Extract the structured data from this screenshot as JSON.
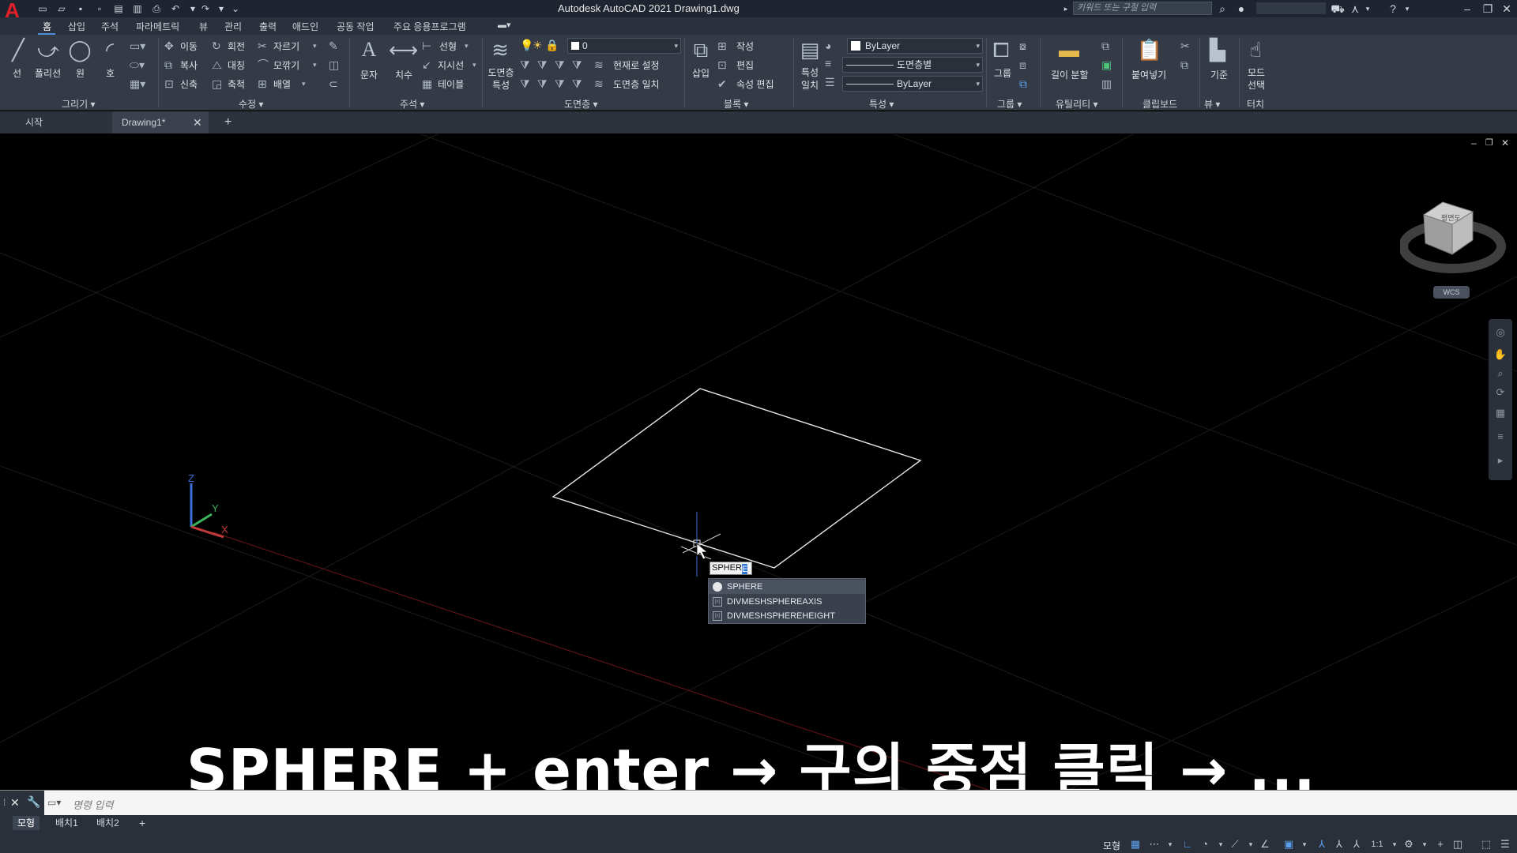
{
  "window": {
    "title": "Autodesk AutoCAD 2021    Drawing1.dwg",
    "search_placeholder": "키워드 또는 구절 입력"
  },
  "menu_tabs": [
    "홈",
    "삽입",
    "주석",
    "파라메트릭",
    "뷰",
    "관리",
    "출력",
    "애드인",
    "공동 작업",
    "주요 응용프로그램"
  ],
  "ribbon": {
    "draw": {
      "title": "그리기 ▾",
      "line": "선",
      "polyline": "폴리선",
      "circle": "원",
      "arc": "호"
    },
    "modify": {
      "title": "수정 ▾",
      "move": "이동",
      "rotate": "회전",
      "trim": "자르기",
      "copy": "복사",
      "mirror": "대칭",
      "fillet": "모깎기",
      "stretch": "신축",
      "scale": "축척",
      "array": "배열"
    },
    "annotation": {
      "title": "주석 ▾",
      "text": "문자",
      "dimension": "치수",
      "linear": "선형",
      "leader": "지시선",
      "table": "테이블"
    },
    "layers": {
      "title": "도면층 ▾",
      "props": "도면층 특성",
      "layer_value": "0",
      "set_current": "현재로 설정",
      "match": "도면층 일치"
    },
    "block": {
      "title": "블록 ▾",
      "insert": "삽입",
      "create": "작성",
      "edit": "편집",
      "edit_attr": "속성 편집"
    },
    "properties": {
      "title": "특성 ▾",
      "match": "특성 일치",
      "color": "ByLayer",
      "linetype": "도면층별",
      "lineweight": "ByLayer"
    },
    "groups": {
      "title": "그룹 ▾",
      "group": "그룹"
    },
    "utilities": {
      "title": "유틸리티 ▾",
      "measure": "길이 분할"
    },
    "clipboard": {
      "title": "클립보드",
      "paste": "붙여넣기"
    },
    "view": {
      "title": "뷰 ▾",
      "base": "기준"
    },
    "touch": {
      "title": "터치",
      "select_mode": "모드 선택"
    }
  },
  "doc_tabs": {
    "start": "시작",
    "drawing": "Drawing1*"
  },
  "viewcube": {
    "top_label": "평면도",
    "wcs": "WCS"
  },
  "command": {
    "typed": "SPHER",
    "cursor_char": "E",
    "suggestions": [
      "SPHERE",
      "DIVMESHSPHEREAXIS",
      "DIVMESHSPHEREHEIGHT"
    ],
    "placeholder": "명령 입력"
  },
  "caption": "SPHERE + enter → 구의 중점 클릭 → ...",
  "layout_tabs": [
    "모형",
    "배치1",
    "배치2"
  ],
  "status": {
    "model": "모형",
    "scale": "1:1"
  },
  "colors": {
    "accent": "#2f78d6",
    "x_axis": "#c23a3a",
    "y_axis": "#3bb35a",
    "z_axis": "#3a6fd8"
  }
}
